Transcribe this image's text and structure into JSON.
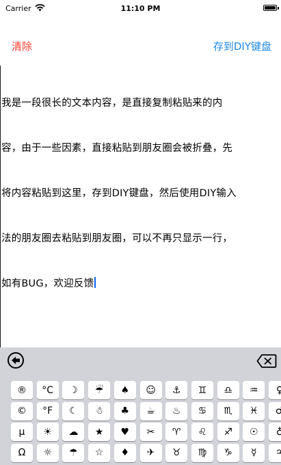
{
  "status_bar": {
    "carrier": "Carrier",
    "time": "11:10 PM",
    "battery_level": 1.0
  },
  "nav": {
    "clear_label": "清除",
    "save_label": "存到DIY键盘"
  },
  "editor": {
    "lines": [
      "我是一段很长的文本内容，是直接复制粘贴来的内",
      "容，由于一些因素，直接粘贴到朋友圈会被折叠，先",
      "将内容粘贴到这里，存到DIY键盘，然后使用DIY输入",
      "法的朋友圈去粘贴到朋友圈，可以不再只显示一行，",
      "如有BUG，欢迎反馈"
    ]
  },
  "keyboard": {
    "toolbar": {
      "back_icon": "circled-left-arrow-icon",
      "delete_icon": "backspace-icon"
    },
    "rows": [
      [
        "®",
        "°C",
        "☽",
        "☔",
        "♠",
        "☺",
        "⚓",
        "♊",
        "♎",
        "♒",
        "♀"
      ],
      [
        "©",
        "°F",
        "☾",
        "☃",
        "♣",
        "☕",
        "♨",
        "♋",
        "♏",
        "♓",
        "♂"
      ],
      [
        "µ",
        "☀",
        "☁",
        "★",
        "♥",
        "✂",
        "♈",
        "♌",
        "♐",
        "☉",
        "♁"
      ],
      [
        "Ω",
        "☼",
        "☂",
        "☆",
        "♦",
        "✈",
        "♉",
        "♍",
        "♑",
        "☿",
        "♃"
      ]
    ]
  }
}
